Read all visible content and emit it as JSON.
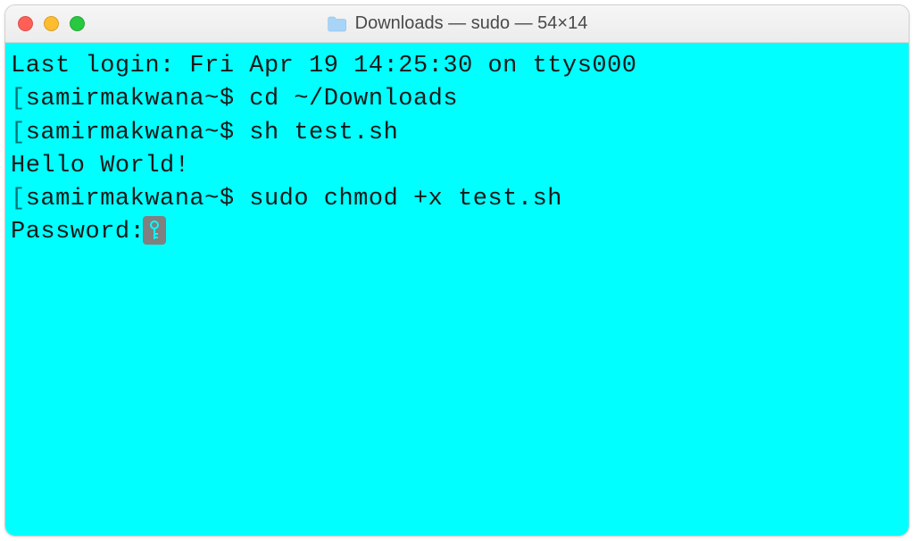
{
  "window": {
    "title": "Downloads — sudo — 54×14"
  },
  "terminal": {
    "last_login": "Last login: Fri Apr 19 14:25:30 on ttys000",
    "prompt_user": "samirmakwana",
    "lines": [
      {
        "prompt": "samirmakwana~$",
        "command": "cd ~/Downloads"
      },
      {
        "prompt": "samirmakwana~$",
        "command": "sh test.sh"
      }
    ],
    "output1": "Hello World!",
    "line3": {
      "prompt": "samirmakwana~$",
      "command": "sudo chmod +x test.sh"
    },
    "password_label": "Password:"
  }
}
